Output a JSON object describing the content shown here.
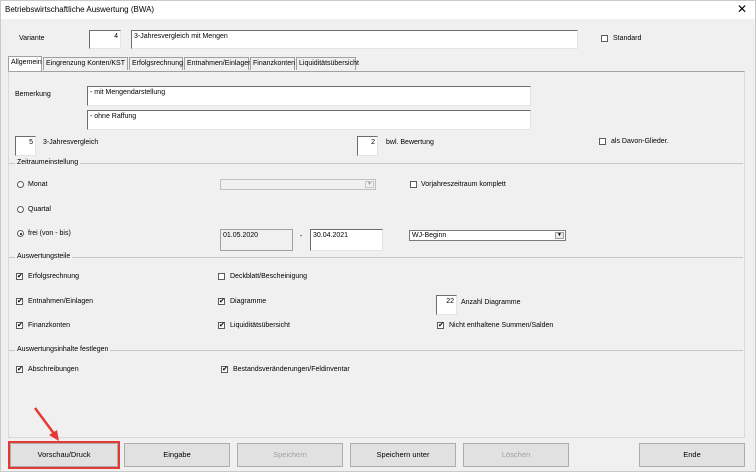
{
  "window": {
    "title": "Betriebswirtschaftliche Auswertung (BWA)",
    "close_glyph": "✕"
  },
  "variante": {
    "label": "Variante",
    "number": "4",
    "name": "3-Jahresvergleich mit Mengen"
  },
  "standard": {
    "label": "Standard",
    "checked": false
  },
  "tabs": [
    {
      "label": "Allgemein"
    },
    {
      "label": "Eingrenzung Konten/KST"
    },
    {
      "label": "Erfolgsrechnung"
    },
    {
      "label": "Entnahmen/Einlagen"
    },
    {
      "label": "Finanzkonten"
    },
    {
      "label": "Liquiditätsübersicht"
    }
  ],
  "bemerkung": {
    "label": "Bemerkung",
    "line1": "- mit Mengendarstellung",
    "line2": "- ohne Raffung"
  },
  "vergleich": {
    "value": "5",
    "label": "3-Jahresvergleich"
  },
  "bewertung": {
    "value": "2",
    "label": "bwl. Bewertung"
  },
  "davon": {
    "label": "als Davon-Glieder.",
    "checked": false
  },
  "zeitraum": {
    "group_label": "Zeitraumeinstellung",
    "monat": "Monat",
    "quartal": "Quartal",
    "frei": "frei (von - bis)",
    "von": "01.05.2020",
    "sep": "-",
    "bis": "30.04.2021",
    "vorjahr": "Vorjahreszeitraum komplett",
    "wj": "WJ-Beginn"
  },
  "auswertungsteile": {
    "group_label": "Auswertungsteile",
    "erfolgsrechnung": "Erfolgsrechnung",
    "deckblatt": "Deckblatt/Bescheinigung",
    "entnahmen": "Entnahmen/Einlagen",
    "diagramme": "Diagramme",
    "anzahl_value": "22",
    "anzahl_label": "Anzahl Diagramme",
    "finanzkonten": "Finanzkonten",
    "liquiditaet": "Liquiditätsübersicht",
    "nicht_enthalten": "Nicht enthaltene Summen/Salden"
  },
  "inhalte": {
    "group_label": "Auswertungsinhalte festlegen",
    "abschreibungen": "Abschreibungen",
    "bestand": "Bestandsveränderungen/Feldinventar"
  },
  "check_glyph": "✔",
  "buttons": {
    "vorschau": "Vorschau/Druck",
    "eingabe": "Eingabe",
    "speichern": "Speichern",
    "speichern_unter": "Speichern unter",
    "loeschen": "Löschen",
    "ende": "Ende"
  },
  "colors": {
    "highlight": "#e53935",
    "arrow": "#e53935"
  }
}
